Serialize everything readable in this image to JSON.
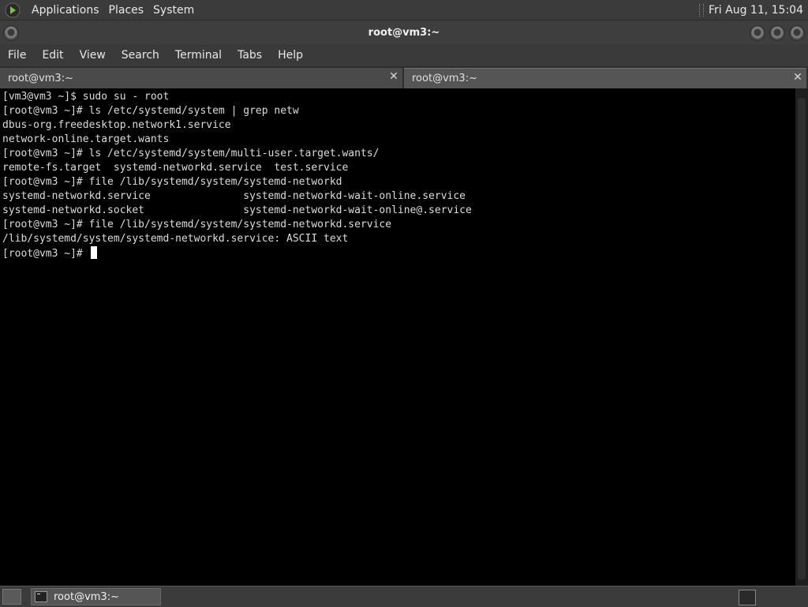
{
  "top_panel": {
    "menus": [
      "Applications",
      "Places",
      "System"
    ],
    "clock": "Fri Aug 11, 15:04"
  },
  "window": {
    "title": "root@vm3:~"
  },
  "menubar": {
    "items": [
      "File",
      "Edit",
      "View",
      "Search",
      "Terminal",
      "Tabs",
      "Help"
    ]
  },
  "tabs": [
    {
      "label": "root@vm3:~",
      "active": false
    },
    {
      "label": "root@vm3:~",
      "active": true
    }
  ],
  "terminal": {
    "lines": [
      "[vm3@vm3 ~]$ sudo su - root",
      "[root@vm3 ~]# ls /etc/systemd/system | grep netw",
      "dbus-org.freedesktop.network1.service",
      "network-online.target.wants",
      "[root@vm3 ~]# ls /etc/systemd/system/multi-user.target.wants/",
      "remote-fs.target  systemd-networkd.service  test.service",
      "[root@vm3 ~]# file /lib/systemd/system/systemd-networkd",
      "systemd-networkd.service               systemd-networkd-wait-online.service",
      "systemd-networkd.socket                systemd-networkd-wait-online@.service",
      "[root@vm3 ~]# file /lib/systemd/system/systemd-networkd.service",
      "/lib/systemd/system/systemd-networkd.service: ASCII text",
      "[root@vm3 ~]# "
    ]
  },
  "taskbar": {
    "window_label": "root@vm3:~"
  },
  "icons": {
    "logo": "distro-logo-icon",
    "terminal": "terminal-icon",
    "show_desktop": "show-desktop-icon",
    "workspace": "workspace-switcher-icon"
  }
}
